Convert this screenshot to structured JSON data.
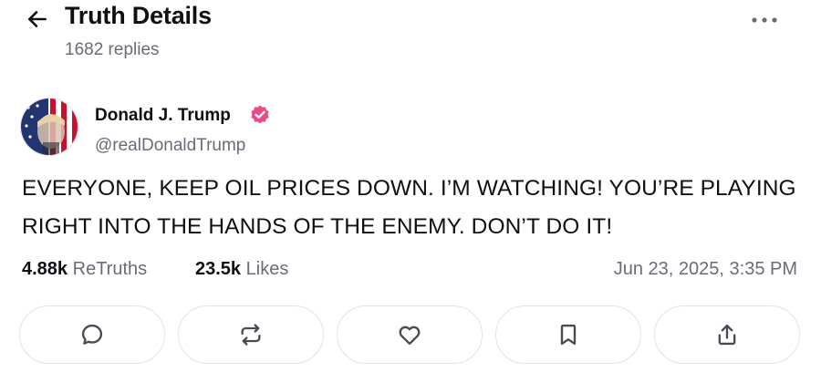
{
  "header": {
    "title": "Truth Details",
    "reply_count": "1682 replies",
    "back_icon": "arrow-left-icon",
    "more_icon": "more-horizontal-icon"
  },
  "author": {
    "display_name": "Donald J. Trump",
    "handle": "@realDonaldTrump",
    "verified_icon": "verified-badge-icon",
    "verified_color": "#e84a8a"
  },
  "post": {
    "text": "EVERYONE, KEEP OIL PRICES DOWN. I’M WATCHING! YOU’RE PLAYING RIGHT INTO THE HANDS OF THE ENEMY. DON’T DO IT!"
  },
  "stats": {
    "retruths_count": "4.88k",
    "retruths_label": "ReTruths",
    "likes_count": "23.5k",
    "likes_label": "Likes",
    "timestamp": "Jun 23, 2025, 3:35 PM"
  },
  "actions": [
    {
      "name": "reply",
      "icon": "reply-bubble-icon"
    },
    {
      "name": "retruth",
      "icon": "repost-icon"
    },
    {
      "name": "like",
      "icon": "heart-icon"
    },
    {
      "name": "bookmark",
      "icon": "bookmark-icon"
    },
    {
      "name": "share",
      "icon": "share-icon"
    }
  ],
  "colors": {
    "text_primary": "#0f0f14",
    "text_secondary": "#6b6b78",
    "border": "#e2e2e8"
  }
}
